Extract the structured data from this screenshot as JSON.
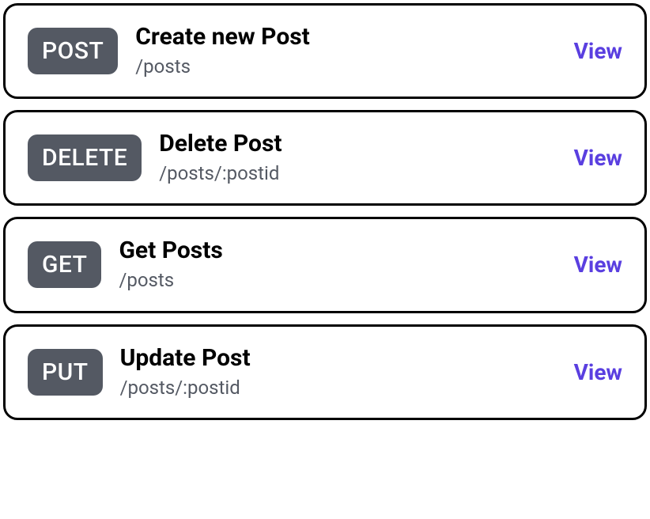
{
  "endpoints": [
    {
      "method": "POST",
      "title": "Create new Post",
      "path": "/posts",
      "action": "View"
    },
    {
      "method": "DELETE",
      "title": "Delete Post",
      "path": "/posts/:postid",
      "action": "View"
    },
    {
      "method": "GET",
      "title": "Get Posts",
      "path": "/posts",
      "action": "View"
    },
    {
      "method": "PUT",
      "title": "Update Post",
      "path": "/posts/:postid",
      "action": "View"
    }
  ]
}
